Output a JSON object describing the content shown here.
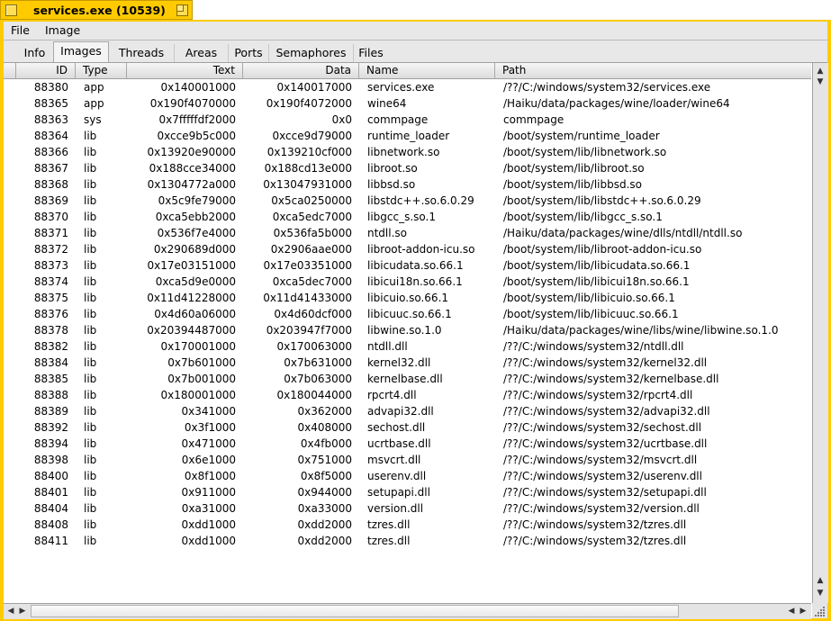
{
  "window": {
    "title": "services.exe (10539)"
  },
  "menu": [
    "File",
    "Image"
  ],
  "tabs": [
    "Info",
    "Images",
    "Threads",
    "Areas",
    "Ports",
    "Semaphores",
    "Files"
  ],
  "active_tab": "Images",
  "columns": [
    "ID",
    "Type",
    "Text",
    "Data",
    "Name",
    "Path"
  ],
  "rows": [
    [
      "88380",
      "app",
      "0x140001000",
      "0x140017000",
      "services.exe",
      "/??/C:/windows/system32/services.exe"
    ],
    [
      "88365",
      "app",
      "0x190f4070000",
      "0x190f4072000",
      "wine64",
      "/Haiku/data/packages/wine/loader/wine64"
    ],
    [
      "88363",
      "sys",
      "0x7fffffdf2000",
      "0x0",
      "commpage",
      "commpage"
    ],
    [
      "88364",
      "lib",
      "0xcce9b5c000",
      "0xcce9d79000",
      "runtime_loader",
      "/boot/system/runtime_loader"
    ],
    [
      "88366",
      "lib",
      "0x13920e90000",
      "0x139210cf000",
      "libnetwork.so",
      "/boot/system/lib/libnetwork.so"
    ],
    [
      "88367",
      "lib",
      "0x188cce34000",
      "0x188cd13e000",
      "libroot.so",
      "/boot/system/lib/libroot.so"
    ],
    [
      "88368",
      "lib",
      "0x1304772a000",
      "0x13047931000",
      "libbsd.so",
      "/boot/system/lib/libbsd.so"
    ],
    [
      "88369",
      "lib",
      "0x5c9fe79000",
      "0x5ca0250000",
      "libstdc++.so.6.0.29",
      "/boot/system/lib/libstdc++.so.6.0.29"
    ],
    [
      "88370",
      "lib",
      "0xca5ebb2000",
      "0xca5edc7000",
      "libgcc_s.so.1",
      "/boot/system/lib/libgcc_s.so.1"
    ],
    [
      "88371",
      "lib",
      "0x536f7e4000",
      "0x536fa5b000",
      "ntdll.so",
      "/Haiku/data/packages/wine/dlls/ntdll/ntdll.so"
    ],
    [
      "88372",
      "lib",
      "0x290689d000",
      "0x2906aae000",
      "libroot-addon-icu.so",
      "/boot/system/lib/libroot-addon-icu.so"
    ],
    [
      "88373",
      "lib",
      "0x17e03151000",
      "0x17e03351000",
      "libicudata.so.66.1",
      "/boot/system/lib/libicudata.so.66.1"
    ],
    [
      "88374",
      "lib",
      "0xca5d9e0000",
      "0xca5dec7000",
      "libicui18n.so.66.1",
      "/boot/system/lib/libicui18n.so.66.1"
    ],
    [
      "88375",
      "lib",
      "0x11d41228000",
      "0x11d41433000",
      "libicuio.so.66.1",
      "/boot/system/lib/libicuio.so.66.1"
    ],
    [
      "88376",
      "lib",
      "0x4d60a06000",
      "0x4d60dcf000",
      "libicuuc.so.66.1",
      "/boot/system/lib/libicuuc.so.66.1"
    ],
    [
      "88378",
      "lib",
      "0x20394487000",
      "0x203947f7000",
      "libwine.so.1.0",
      "/Haiku/data/packages/wine/libs/wine/libwine.so.1.0"
    ],
    [
      "88382",
      "lib",
      "0x170001000",
      "0x170063000",
      "ntdll.dll",
      "/??/C:/windows/system32/ntdll.dll"
    ],
    [
      "88384",
      "lib",
      "0x7b601000",
      "0x7b631000",
      "kernel32.dll",
      "/??/C:/windows/system32/kernel32.dll"
    ],
    [
      "88385",
      "lib",
      "0x7b001000",
      "0x7b063000",
      "kernelbase.dll",
      "/??/C:/windows/system32/kernelbase.dll"
    ],
    [
      "88388",
      "lib",
      "0x180001000",
      "0x180044000",
      "rpcrt4.dll",
      "/??/C:/windows/system32/rpcrt4.dll"
    ],
    [
      "88389",
      "lib",
      "0x341000",
      "0x362000",
      "advapi32.dll",
      "/??/C:/windows/system32/advapi32.dll"
    ],
    [
      "88392",
      "lib",
      "0x3f1000",
      "0x408000",
      "sechost.dll",
      "/??/C:/windows/system32/sechost.dll"
    ],
    [
      "88394",
      "lib",
      "0x471000",
      "0x4fb000",
      "ucrtbase.dll",
      "/??/C:/windows/system32/ucrtbase.dll"
    ],
    [
      "88398",
      "lib",
      "0x6e1000",
      "0x751000",
      "msvcrt.dll",
      "/??/C:/windows/system32/msvcrt.dll"
    ],
    [
      "88400",
      "lib",
      "0x8f1000",
      "0x8f5000",
      "userenv.dll",
      "/??/C:/windows/system32/userenv.dll"
    ],
    [
      "88401",
      "lib",
      "0x911000",
      "0x944000",
      "setupapi.dll",
      "/??/C:/windows/system32/setupapi.dll"
    ],
    [
      "88404",
      "lib",
      "0xa31000",
      "0xa33000",
      "version.dll",
      "/??/C:/windows/system32/version.dll"
    ],
    [
      "88408",
      "lib",
      "0xdd1000",
      "0xdd2000",
      "tzres.dll",
      "/??/C:/windows/system32/tzres.dll"
    ],
    [
      "88411",
      "lib",
      "0xdd1000",
      "0xdd2000",
      "tzres.dll",
      "/??/C:/windows/system32/tzres.dll"
    ]
  ],
  "icons": {
    "close": "close-box-icon",
    "zoom": "zoom-box-icon",
    "scroll_up": "arrow-up-icon",
    "scroll_down": "arrow-down-icon",
    "scroll_left": "arrow-left-icon",
    "scroll_right": "arrow-right-icon",
    "resize": "resize-grip-icon"
  },
  "colors": {
    "window_tab": "#ffcb00",
    "panel": "#e8e8e8",
    "list_bg": "#ffffff"
  }
}
